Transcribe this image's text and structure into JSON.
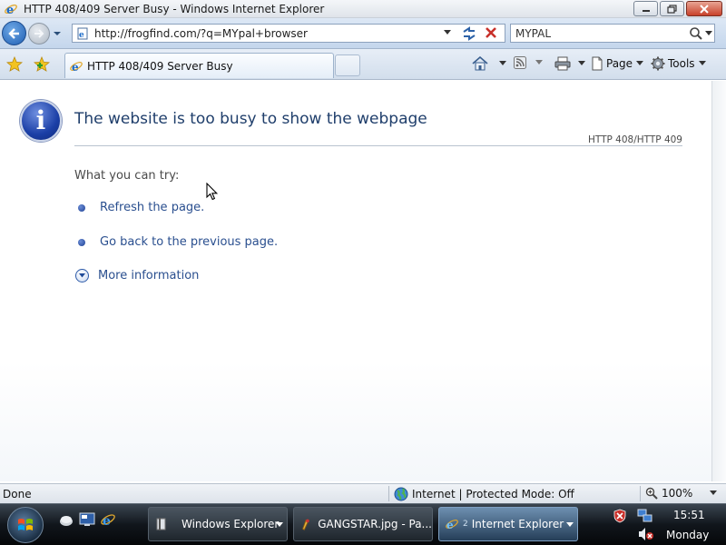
{
  "window": {
    "title": "HTTP 408/409 Server Busy - Windows Internet Explorer"
  },
  "navbar": {
    "url": "http://frogfind.com/?q=MYpal+browser",
    "search_value": "MYPAL"
  },
  "tabs": {
    "active_tab_label": "HTTP 408/409 Server Busy"
  },
  "command_bar": {
    "page_label": "Page",
    "tools_label": "Tools"
  },
  "content": {
    "heading": "The website is too busy to show the webpage",
    "error_code": "HTTP 408/HTTP 409",
    "try_label": "What you can try:",
    "options": [
      {
        "label": "Refresh the page."
      },
      {
        "label": "Go back to the previous page."
      }
    ],
    "more_info_label": "More information"
  },
  "status": {
    "text": "Done",
    "zone": "Internet | Protected Mode: Off",
    "zoom": "100%"
  },
  "taskbar": {
    "items": [
      {
        "label": "Windows Explorer"
      },
      {
        "label": "GANGSTAR.jpg - Pa..."
      },
      {
        "label": "Internet Explorer",
        "count": "2"
      }
    ],
    "clock": "15:51",
    "day": "Monday"
  },
  "colors": {
    "heading": "#1f3e6b",
    "link": "#2a4f8f",
    "taskbar": "#11161c"
  }
}
